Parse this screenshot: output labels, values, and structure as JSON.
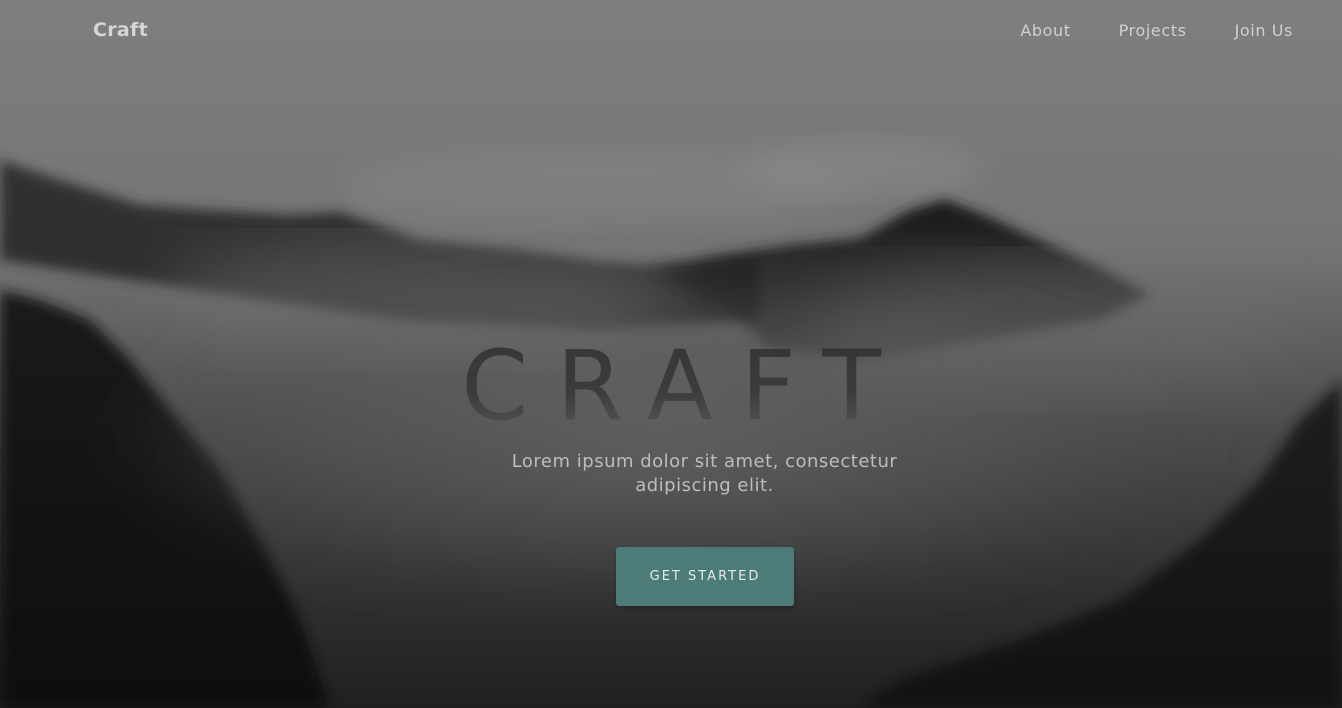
{
  "header": {
    "brand": "Craft",
    "nav": [
      {
        "label": "About"
      },
      {
        "label": "Projects"
      },
      {
        "label": "Join Us"
      }
    ]
  },
  "hero": {
    "title": "CRAFT",
    "subtitle": "Lorem ipsum dolor sit amet, consectetur adipiscing elit.",
    "cta_label": "GET STARTED",
    "background": "misty-mountains-forest-photo"
  },
  "colors": {
    "accent": "#4c7b78",
    "nav_text": "#d0d0d0",
    "subtitle_text": "#bdbdbd"
  }
}
